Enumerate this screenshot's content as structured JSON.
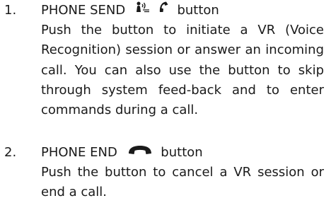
{
  "items": [
    {
      "number": "1.",
      "title_before": "PHONE SEND",
      "icons": [
        "voice-recognition-icon",
        "phone-handset-icon"
      ],
      "title_after": "button",
      "description": "Push the button to initiate a VR (Voice Recognition) session or answer an incoming call. You can also use the button to skip through system feed-back and to enter commands during a call."
    },
    {
      "number": "2.",
      "title_before": "PHONE END",
      "icons": [
        "phone-hangup-icon"
      ],
      "title_after": "button",
      "description": "Push the button to cancel a VR session or end a call."
    }
  ]
}
